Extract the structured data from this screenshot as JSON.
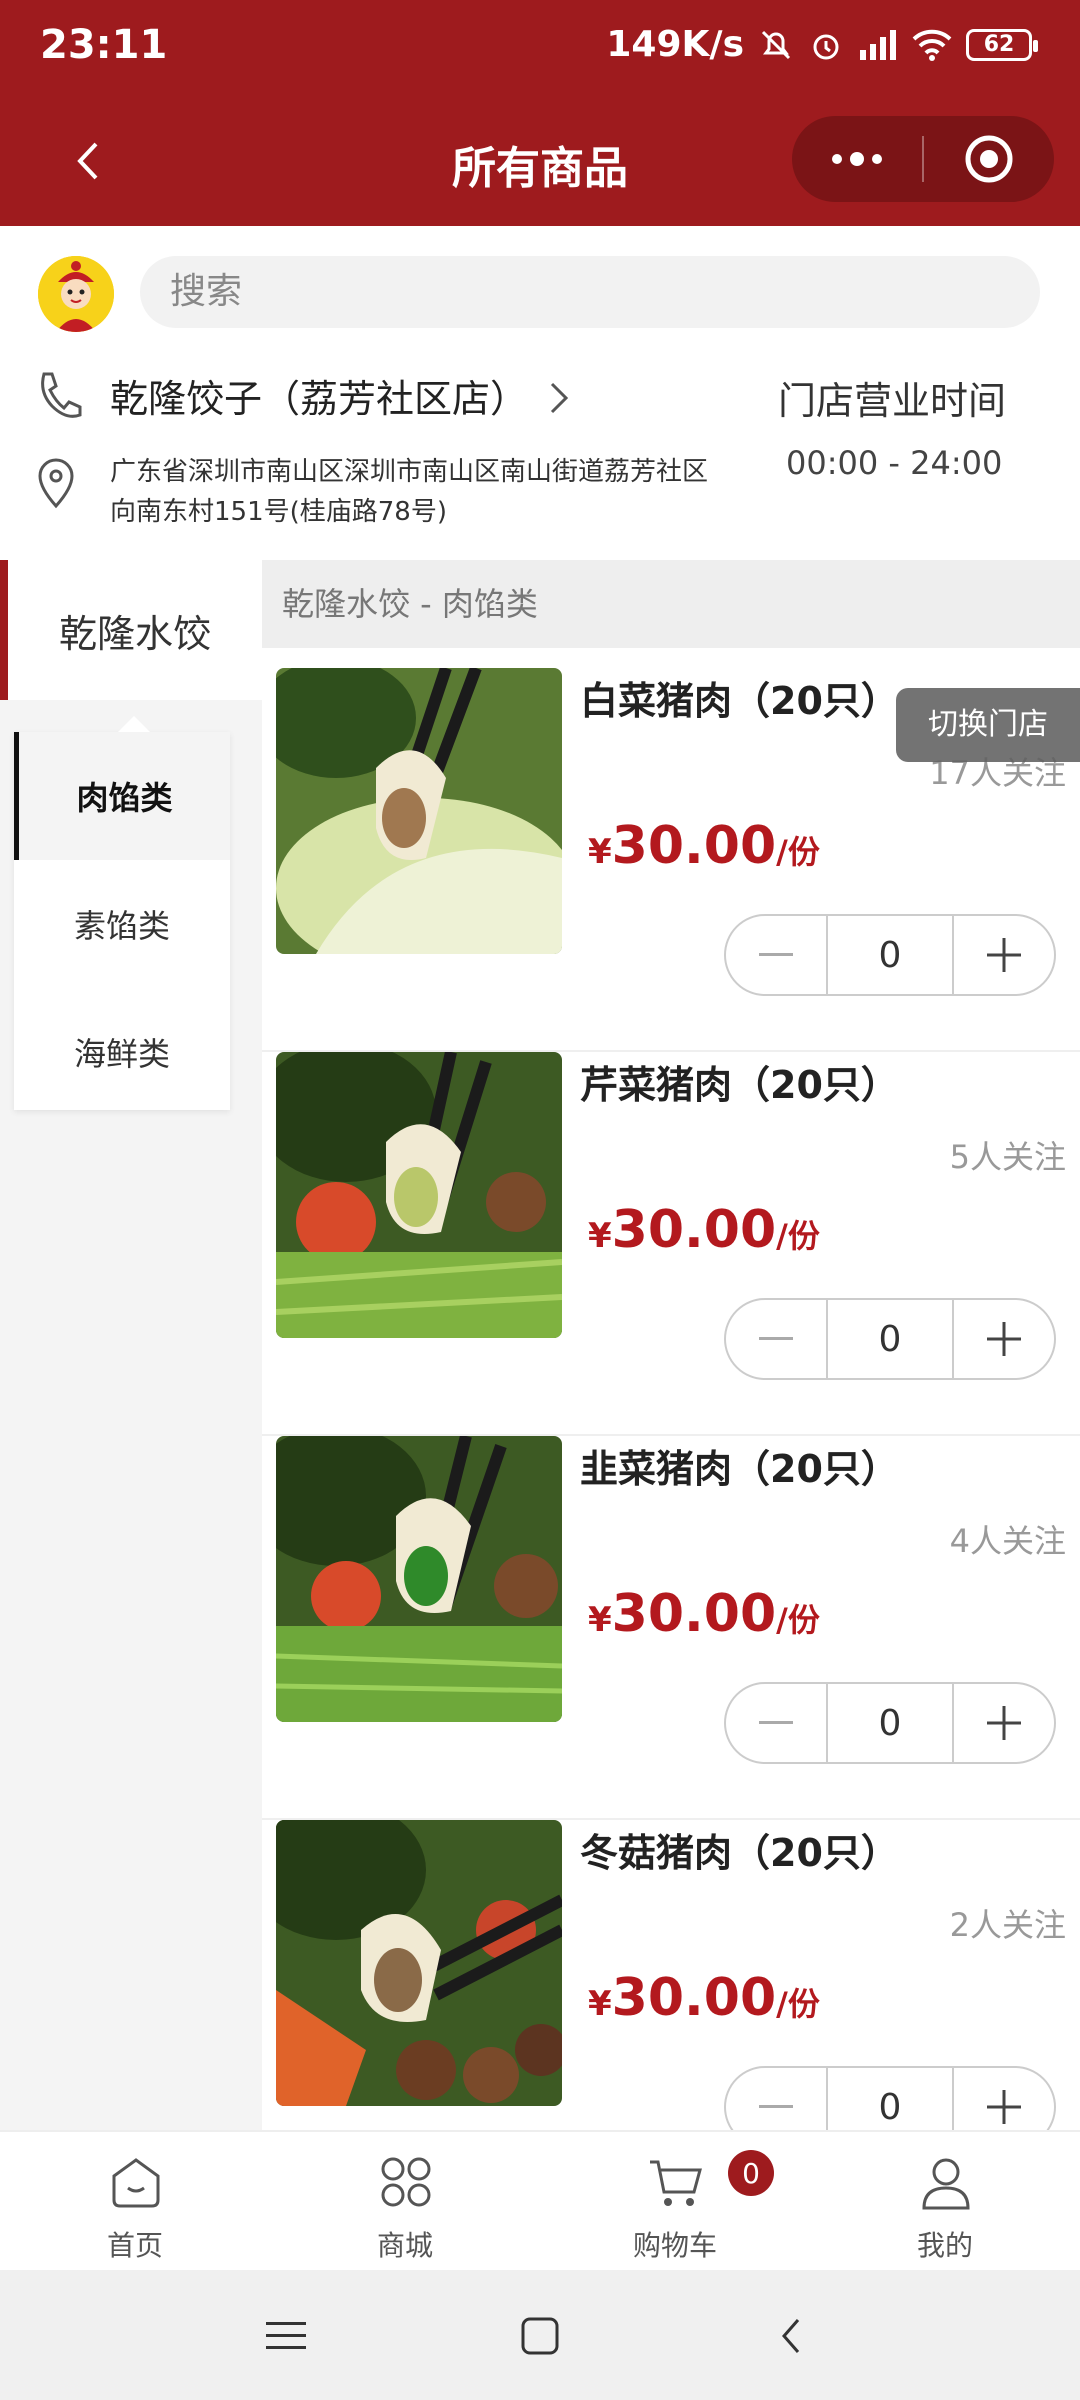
{
  "status_bar": {
    "time": "23:11",
    "net_speed": "149K/s",
    "battery": "62"
  },
  "nav": {
    "title": "所有商品"
  },
  "search": {
    "placeholder": "搜索"
  },
  "store": {
    "name": "乾隆饺子（荔芳社区店）",
    "address": "广东省深圳市南山区深圳市南山区南山街道荔芳社区向南东村151号(桂庙路78号)",
    "hours_title": "门店营业时间",
    "hours": "00:00 - 24:00"
  },
  "category": {
    "brand": "乾隆水饺",
    "subcategories": [
      "肉馅类",
      "素馅类",
      "海鲜类"
    ],
    "header": "乾隆水饺 - 肉馅类"
  },
  "switch_store": "切换门店",
  "products": [
    {
      "name": "白菜猪肉（20只）",
      "followers": "17人关注",
      "currency": "¥",
      "price": "30.00",
      "unit": "/份",
      "qty": "0"
    },
    {
      "name": "芹菜猪肉（20只）",
      "followers": "5人关注",
      "currency": "¥",
      "price": "30.00",
      "unit": "/份",
      "qty": "0"
    },
    {
      "name": "韭菜猪肉（20只）",
      "followers": "4人关注",
      "currency": "¥",
      "price": "30.00",
      "unit": "/份",
      "qty": "0"
    },
    {
      "name": "冬菇猪肉（20只）",
      "followers": "2人关注",
      "currency": "¥",
      "price": "30.00",
      "unit": "/份",
      "qty": "0"
    }
  ],
  "tabs": [
    {
      "label": "首页",
      "icon": "home-icon"
    },
    {
      "label": "商城",
      "icon": "grid-icon"
    },
    {
      "label": "购物车",
      "icon": "cart-icon",
      "badge": "0"
    },
    {
      "label": "我的",
      "icon": "user-icon"
    }
  ],
  "colors": {
    "brand": "#9e1b1e",
    "price": "#b3191e"
  }
}
